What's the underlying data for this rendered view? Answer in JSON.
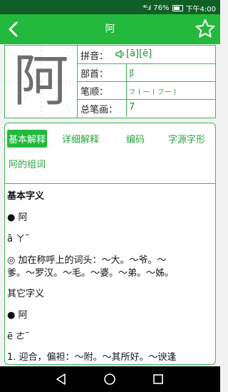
{
  "status": {
    "signal": "⁴ᴳ.ıl",
    "battery": "76%",
    "time": "下午4:00"
  },
  "appbar": {
    "title": "阿"
  },
  "character": "阿",
  "info": {
    "pinyin_label": "拼音：",
    "pinyin_value": "[ā][ē]",
    "radical_label": "部首：",
    "radical_value": "阝",
    "strokes_label": "笔顺：",
    "strokes_value": "フ丨一丨フ一丨",
    "total_label": "总笔画：",
    "total_value": "7"
  },
  "tabs": [
    "基本解释",
    "详细解释",
    "编码",
    "字源字形",
    "阿的组词"
  ],
  "content": {
    "heading": "基本字义",
    "entry1_bullet": "● 阿",
    "entry1_pinyin": "ā ㄚˉ",
    "entry1_def_line1": "◎ 加在称呼上的词头：～大。～爷。～",
    "entry1_def_line2": "爹。～罗汉。～毛。～婆。～弟。～姊。",
    "other_heading": "其它字义",
    "entry2_bullet": "● 阿",
    "entry2_pinyin": "ē ㄜˉ",
    "entry2_def_line1": "1. 迎合，偏袒：～附。～其所好。～谀逢"
  }
}
